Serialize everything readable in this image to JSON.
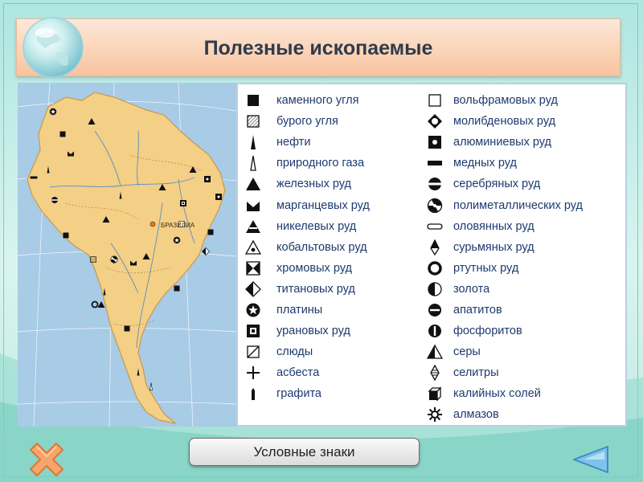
{
  "title": "Полезные ископаемые",
  "map": {
    "city_label": "БРАЗИЛИА",
    "land_color": "#f4cf86",
    "sea_color": "#a8cbe6"
  },
  "legend": {
    "left": [
      {
        "label": "каменного угля",
        "icon": "square-filled-icon"
      },
      {
        "label": "бурого угля",
        "icon": "square-hatched-icon"
      },
      {
        "label": "нефти",
        "icon": "narrow-triangle-filled-icon"
      },
      {
        "label": "природного газа",
        "icon": "narrow-triangle-outline-icon"
      },
      {
        "label": "железных руд",
        "icon": "triangle-filled-icon"
      },
      {
        "label": "марганцевых руд",
        "icon": "crown-icon"
      },
      {
        "label": "никелевых руд",
        "icon": "triangle-stripe-icon"
      },
      {
        "label": "кобальтовых руд",
        "icon": "triangle-dot-icon"
      },
      {
        "label": "хромовых руд",
        "icon": "bowtie-square-icon"
      },
      {
        "label": "титановых руд",
        "icon": "half-diamond-icon"
      },
      {
        "label": "платины",
        "icon": "circle-star-icon"
      },
      {
        "label": "урановых руд",
        "icon": "square-inner-square-icon"
      },
      {
        "label": "слюды",
        "icon": "square-diagonal-icon"
      },
      {
        "label": "асбеста",
        "icon": "plus-icon"
      },
      {
        "label": "графита",
        "icon": "small-bar-icon"
      }
    ],
    "right": [
      {
        "label": "вольфрамовых руд",
        "icon": "square-outline-icon"
      },
      {
        "label": "молибденовых руд",
        "icon": "circle-diamond-icon"
      },
      {
        "label": "алюминиевых руд",
        "icon": "square-dot-icon"
      },
      {
        "label": "медных руд",
        "icon": "horizontal-bar-icon"
      },
      {
        "label": "серебряных руд",
        "icon": "circle-band-icon"
      },
      {
        "label": "полиметаллических руд",
        "icon": "radiation-icon"
      },
      {
        "label": "оловянных руд",
        "icon": "rounded-bar-outline-icon"
      },
      {
        "label": "сурьмяных руд",
        "icon": "pointed-diamond-icon"
      },
      {
        "label": "ртутных руд",
        "icon": "ring-icon"
      },
      {
        "label": "золота",
        "icon": "half-circle-icon"
      },
      {
        "label": "апатитов",
        "icon": "circle-line-icon"
      },
      {
        "label": "фосфоритов",
        "icon": "circle-center-line-icon"
      },
      {
        "label": "серы",
        "icon": "triangle-half-icon"
      },
      {
        "label": "селитры",
        "icon": "striped-diamond-icon"
      },
      {
        "label": "калийных солей",
        "icon": "cube-icon"
      },
      {
        "label": "алмазов",
        "icon": "gear-sun-icon"
      }
    ]
  },
  "buttons": {
    "legend_button": "Условные знаки"
  }
}
